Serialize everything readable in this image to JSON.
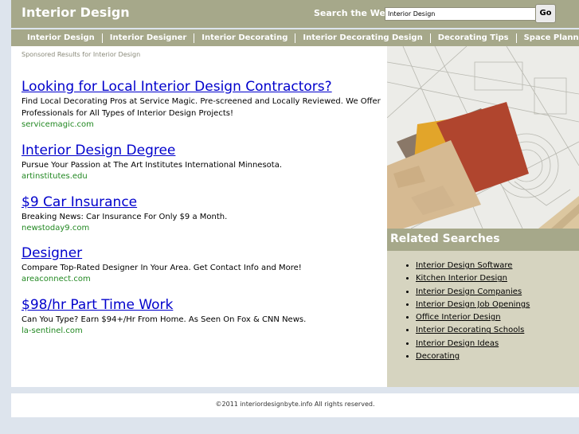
{
  "header": {
    "title": "Interior Design",
    "search_label": "Search the Web:",
    "search_value": "Interior Design",
    "go_label": "Go"
  },
  "nav": {
    "items": [
      {
        "label": "Interior Design"
      },
      {
        "label": "Interior Designer"
      },
      {
        "label": "Interior Decorating"
      },
      {
        "label": "Interior Decorating Design"
      },
      {
        "label": "Decorating Tips"
      },
      {
        "label": "Space Planning"
      }
    ]
  },
  "main": {
    "sponsored_label": "Sponsored Results for Interior Design",
    "results": [
      {
        "title": "Looking for Local Interior Design Contractors?",
        "desc": "Find Local Decorating Pros at Service Magic. Pre-screened and Locally Reviewed. We Offer Professionals for All Types of Interior Design Projects!",
        "url": "servicemagic.com"
      },
      {
        "title": "Interior Design Degree",
        "desc": "Pursue Your Passion at The Art Institutes International Minnesota.",
        "url": "artinstitutes.edu"
      },
      {
        "title": "$9 Car Insurance",
        "desc": "Breaking News: Car Insurance For Only $9 a Month.",
        "url": "newstoday9.com"
      },
      {
        "title": "Designer",
        "desc": "Compare Top-Rated Designer In Your Area. Get Contact Info and More!",
        "url": "areaconnect.com"
      },
      {
        "title": "$98/hr Part Time Work",
        "desc": "Can You Type? Earn $94+/Hr From Home. As Seen On Fox & CNN News.",
        "url": "la-sentinel.com"
      }
    ]
  },
  "sidebar": {
    "related_title": "Related Searches",
    "related": [
      {
        "label": "Interior Design Software"
      },
      {
        "label": "Kitchen Interior Design"
      },
      {
        "label": "Interior Design Companies"
      },
      {
        "label": "Interior Design Job Openings"
      },
      {
        "label": "Office Interior Design"
      },
      {
        "label": "Interior Decorating Schools"
      },
      {
        "label": "Interior Design Ideas"
      },
      {
        "label": "Decorating"
      }
    ]
  },
  "footer": {
    "copyright": "©2011 interiordesignbyte.info All rights reserved."
  },
  "colors": {
    "accent": "#a6a88a",
    "link": "#0000cc",
    "url": "#228822",
    "sidebar_bg": "#d6d4c0",
    "page_bg": "#dde4ed"
  }
}
